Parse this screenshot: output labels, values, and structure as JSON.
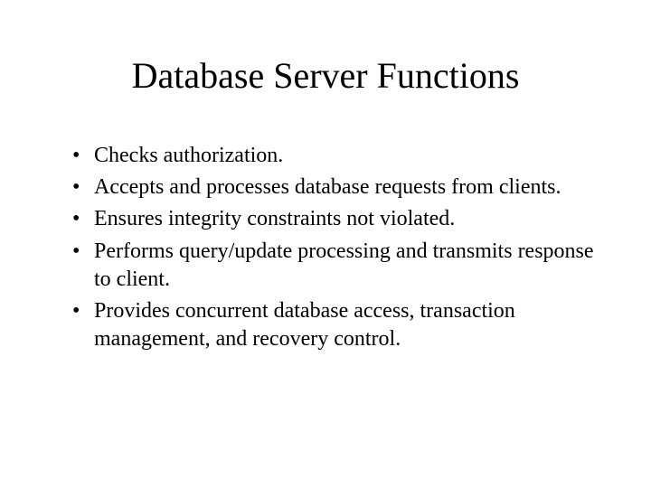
{
  "title": "Database Server Functions",
  "bullets": [
    "Checks authorization.",
    "Accepts and processes database requests from clients.",
    "Ensures integrity constraints not violated.",
    "Performs query/update processing and transmits response to client.",
    "Provides concurrent database access, transaction management, and recovery control."
  ]
}
